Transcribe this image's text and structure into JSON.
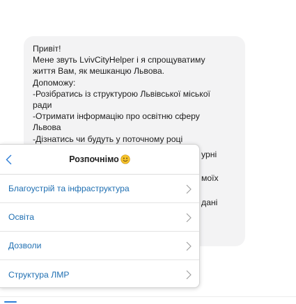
{
  "message": {
    "lines": [
      "Привіт!",
      "Мене звуть LvivCityHelper і я спрощуватиму",
      "життя Вам, як мешканцю Львова.",
      "Допоможу:",
      "-Розібратись із структурою Львівської міської",
      "ради",
      "-Отримати інформацію про освітню сферу",
      "Львова",
      "-Дізнатись чи будуть у поточному році"
    ],
    "peek_fragments": [
      "урні",
      "моїх",
      "дані"
    ]
  },
  "menu": {
    "title": "Розпочнімо",
    "title_emoji": "smiling-face",
    "back_icon": "chevron-left-icon",
    "items": [
      {
        "label": "Благоустрій та інфраструктура"
      },
      {
        "label": "Освіта"
      },
      {
        "label": "Дозволи"
      },
      {
        "label": "Структура ЛМР"
      }
    ]
  },
  "colors": {
    "link": "#1f6fb2",
    "bubble_bg": "#f3f3f4",
    "accent": "#2b7bd6"
  }
}
